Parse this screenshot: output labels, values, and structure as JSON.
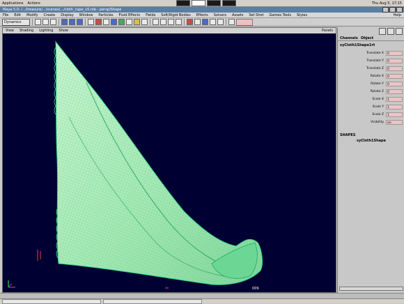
{
  "os_bar": {
    "apps_label": "Applications",
    "actions_label": "Actions",
    "datetime": "Thu Aug 5, 17:15"
  },
  "title_bar": {
    "title": "Maya 5.0: /.../treasure/.../scenes/.../cloth_cape_v5.mb   - persp/Shape"
  },
  "menu": {
    "items": [
      "File",
      "Edit",
      "Modify",
      "Create",
      "Display",
      "Window",
      "Particles",
      "Fluid Effects",
      "Fields",
      "Soft/Rigid Bodies",
      "Effects",
      "Solvers",
      "Assets",
      "Set Shot",
      "Games Tools",
      "Styles"
    ],
    "help": "Help"
  },
  "toolbar": {
    "mode": "Dynamics"
  },
  "viewport": {
    "menu": [
      "View",
      "Shading",
      "Lighting",
      "Show"
    ],
    "panels_label": "Panels",
    "frame_label": "009"
  },
  "channel_box": {
    "tabs": [
      "Channels",
      "Object"
    ],
    "object_name": "syCloth1Shape1rt",
    "attrs": [
      {
        "label": "Translate X",
        "value": "0"
      },
      {
        "label": "Translate Y",
        "value": "0"
      },
      {
        "label": "Translate Z",
        "value": "0"
      },
      {
        "label": "Rotate X",
        "value": "0"
      },
      {
        "label": "Rotate Y",
        "value": "0"
      },
      {
        "label": "Rotate Z",
        "value": "0"
      },
      {
        "label": "Scale X",
        "value": "1"
      },
      {
        "label": "Scale Y",
        "value": "1"
      },
      {
        "label": "Scale Z",
        "value": "1"
      },
      {
        "label": "Visibility",
        "value": "on"
      }
    ],
    "shapes_label": "SHAPES",
    "shape_name": "syCloth1Shape"
  },
  "colors": {
    "viewport_bg": "#000033",
    "cloth_fill": "#a8f0b8",
    "cloth_edge": "#2ed88a",
    "attr_field": "#ecc4c4"
  }
}
